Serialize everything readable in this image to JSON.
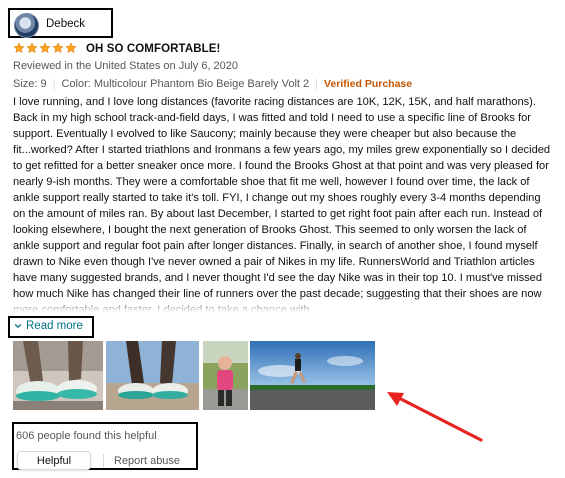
{
  "review": {
    "reviewer": "Debeck",
    "rating": 5,
    "rating_max": 5,
    "star_color": "#ffa41c",
    "title": "OH SO COMFORTABLE!",
    "reviewed_in": "Reviewed in the United States on July 6, 2020",
    "size": "Size: 9",
    "color": "Color: Multicolour Phantom Bio Beige Barely Volt 2",
    "verified": "Verified Purchase",
    "verified_color": "#c45500",
    "body": "I love running, and I love long distances (favorite racing distances are 10K, 12K, 15K, and half marathons). Back in my high school track-and-field days, I was fitted and told I need to use a specific line of Brooks for support. Eventually I evolved to like Saucony; mainly because they were cheaper but also because the fit...worked? After I started triathlons and Ironmans a few years ago, my miles grew exponentially so I decided to get refitted for a better sneaker once more. I found the Brooks Ghost at that point and was very pleased for nearly 9-ish months. They were a comfortable shoe that fit me well, however I found over time, the lack of ankle support really started to take it's toll. FYI, I change out my shoes roughly every 3-4 months depending on the amount of miles ran. By about last December, I started to get right foot pain after each run. Instead of looking elsewhere, I bought the next generation of Brooks Ghost. This seemed to only worsen the lack of ankle support and regular foot pain after longer distances. Finally, in search of another shoe, I found myself drawn to Nike even though I've never owned a pair of Nikes in my life. RunnersWorld and Triathlon articles have many suggested brands, and I never thought I'd see the day Nike was in their top 10. I must've missed how much Nike has changed their line of runners over the past decade; suggesting that their shoes are now more comfortable and faster. I decided to take a chance with",
    "read_more": "Read more",
    "read_more_icon": "chevron-down-icon",
    "images": [
      "shoe-closeup-photo",
      "runner-shoes-photo",
      "runner-selfie-photo",
      "runner-on-road-photo"
    ],
    "helpful_count": "606 people found this helpful",
    "helpful_button": "Helpful",
    "report_abuse": "Report abuse",
    "link_color": "#007185",
    "annotation_color": "#e8231d"
  }
}
